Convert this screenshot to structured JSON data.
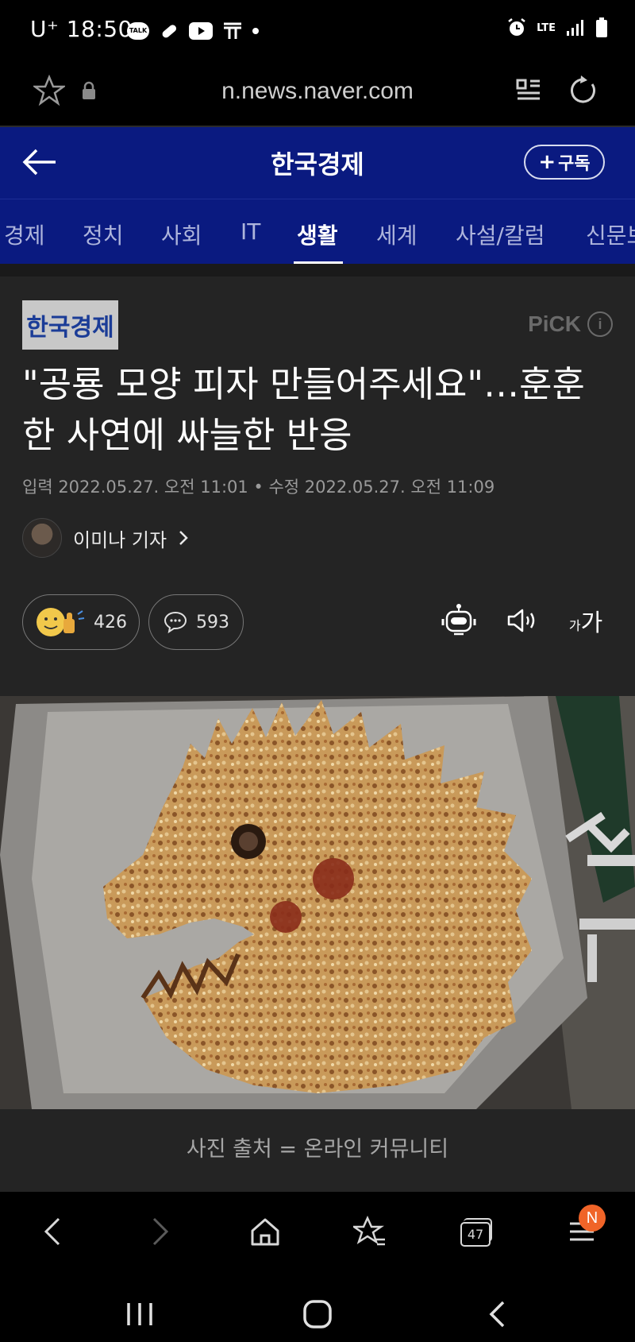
{
  "status_bar": {
    "carrier": "U⁺",
    "time": "18:50",
    "talk_badge": "TALK",
    "network": "LTE"
  },
  "browser": {
    "url": "n.news.naver.com",
    "bottom_nav": {
      "tabs_count": "47",
      "menu_badge": "N"
    }
  },
  "header": {
    "title": "한국경제",
    "subscribe_label": "구독"
  },
  "tabs": [
    {
      "label": "경제",
      "active": false
    },
    {
      "label": "정치",
      "active": false
    },
    {
      "label": "사회",
      "active": false
    },
    {
      "label": "IT",
      "active": false
    },
    {
      "label": "생활",
      "active": true
    },
    {
      "label": "세계",
      "active": false
    },
    {
      "label": "사설/칼럼",
      "active": false
    },
    {
      "label": "신문보",
      "active": false
    }
  ],
  "article": {
    "publisher": "한국경제",
    "pick_label": "PiCK",
    "headline": "\"공룡 모양 피자 만들어주세요\"…훈훈한 사연에 싸늘한 반응",
    "dates": "입력 2022.05.27. 오전 11:01 • 수정 2022.05.27. 오전 11:09",
    "reporter": "이미나 기자",
    "reactions_count": "426",
    "comments_count": "593",
    "font_size_small": "가",
    "font_size_large": "가",
    "photo_caption": "사진 출처 = 온라인 커뮤니티"
  }
}
